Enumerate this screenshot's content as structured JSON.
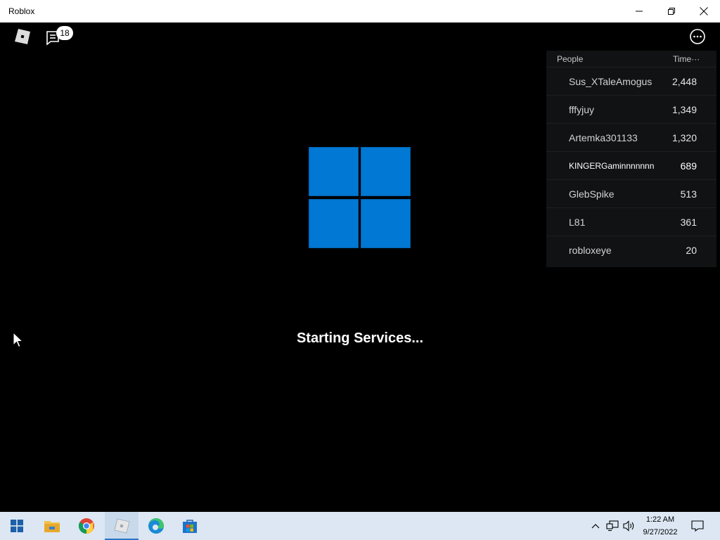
{
  "window": {
    "title": "Roblox",
    "controls": [
      "minimize-icon",
      "restore-icon",
      "close-icon"
    ]
  },
  "topbar": {
    "menu_icon": "roblox-logo-icon",
    "chat_icon": "chat-icon",
    "chat_badge": "18",
    "more_icon": "more-options-icon"
  },
  "leaderboard": {
    "header": {
      "people": "People",
      "time": "Time···"
    },
    "rows": [
      {
        "name": "Sus_XTaleAmogus",
        "value": "2,448"
      },
      {
        "name": "fffyjuy",
        "value": "1,349"
      },
      {
        "name": "Artemka301133",
        "value": "1,320"
      },
      {
        "name": "KINGERGaminnnnnnn",
        "value": "689"
      },
      {
        "name": "GlebSpike",
        "value": "513"
      },
      {
        "name": "L81",
        "value": "361"
      },
      {
        "name": "robloxeye",
        "value": "20"
      }
    ]
  },
  "loading": {
    "status": "Starting Services...",
    "logo": "windows-logo-icon",
    "logo_color": "#0078d4"
  },
  "taskbar": {
    "apps": [
      "start-icon",
      "file-explorer-icon",
      "chrome-icon",
      "roblox-icon",
      "edge-icon",
      "microsoft-store-icon"
    ],
    "tray": [
      "show-hidden-icons-icon",
      "network-icon",
      "volume-icon",
      "notifications-icon"
    ],
    "time": "1:22 AM",
    "date": "9/27/2022",
    "accent": "#2b74c7"
  }
}
